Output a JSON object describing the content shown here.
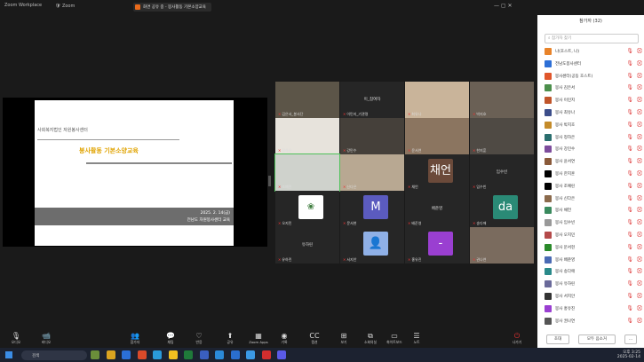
{
  "window": {
    "title": "Zoom",
    "app_label": "Zoom Workplace"
  },
  "share_bar": {
    "label": "화면 공유 중 - 봉사활동 기본소양교육"
  },
  "slide": {
    "header": "사회복지법인 자원봉사센터",
    "title": "봉사활동 기본소양교육",
    "line1": "2025. 2. 14(금)",
    "line2": "전남도 자원봉사센터 교육"
  },
  "gallery": [
    {
      "name": "김은서_봉사단",
      "kind": "video",
      "color": "#5c5548"
    },
    {
      "name": "이민지_기관명",
      "kind": "name",
      "center": "이_참여자"
    },
    {
      "name": "최유나",
      "kind": "video",
      "color": "#c9b49a"
    },
    {
      "name": "박지호",
      "kind": "video",
      "color": "#6a6055"
    },
    {
      "name": "정하은",
      "kind": "video",
      "color": "#e7e3dc"
    },
    {
      "name": "강민수",
      "kind": "video",
      "color": "#45403a"
    },
    {
      "name": "윤서연",
      "kind": "video",
      "color": "#8b7560"
    },
    {
      "name": "한지훈",
      "kind": "video",
      "color": "#4f4a44"
    },
    {
      "name": "조예린",
      "kind": "video",
      "color": "#cfd2cc",
      "active": true
    },
    {
      "name": "신다은",
      "kind": "video",
      "color": "#b8a892"
    },
    {
      "name": "채언",
      "kind": "avatar",
      "letter": "채언",
      "color": "#6b4a3a"
    },
    {
      "name": "임수빈",
      "kind": "name",
      "center": "임수빈"
    },
    {
      "name": "오지민",
      "kind": "logo",
      "color": "#fff"
    },
    {
      "name": "문서현",
      "kind": "avatar",
      "letter": "M",
      "color": "#5b5bbf"
    },
    {
      "name": "배준영",
      "kind": "name",
      "center": "배준영"
    },
    {
      "name": "송다애",
      "kind": "avatar",
      "letter": "da",
      "color": "#2a8a76"
    },
    {
      "name": "유하린",
      "kind": "name",
      "center": "유하린"
    },
    {
      "name": "서지안",
      "kind": "person",
      "color": "#3a5fa8"
    },
    {
      "name": "홍유진",
      "kind": "avatar",
      "letter": "-",
      "color": "#9a3fd1"
    },
    {
      "name": "권나연",
      "kind": "video",
      "color": "#7a6b5e"
    }
  ],
  "toolbar": [
    {
      "label": "오디오",
      "icon": "mic-icon",
      "glyph": "🎙"
    },
    {
      "label": "비디오",
      "icon": "camera-icon",
      "glyph": "📹"
    },
    {
      "label": "참가자",
      "icon": "participants-icon",
      "glyph": "👥"
    },
    {
      "label": "채팅",
      "icon": "chat-icon",
      "glyph": "💬"
    },
    {
      "label": "반응",
      "icon": "heart-icon",
      "glyph": "♡"
    },
    {
      "label": "공유",
      "icon": "share-icon",
      "glyph": "⬆"
    },
    {
      "label": "Zoom Apps",
      "icon": "apps-icon",
      "glyph": "▦"
    },
    {
      "label": "기록",
      "icon": "record-icon",
      "glyph": "◉"
    },
    {
      "label": "캡션",
      "icon": "caption-icon",
      "glyph": "CC"
    },
    {
      "label": "보기",
      "icon": "view-icon",
      "glyph": "⊞"
    },
    {
      "label": "소회의실",
      "icon": "breakout-icon",
      "glyph": "⧉"
    },
    {
      "label": "화이트보드",
      "icon": "whiteboard-icon",
      "glyph": "▭"
    },
    {
      "label": "노트",
      "icon": "notes-icon",
      "glyph": "☰"
    },
    {
      "label": "나가기",
      "icon": "leave-icon",
      "glyph": "⏻"
    }
  ],
  "panel": {
    "title": "참가자 (32)",
    "search_placeholder": "참가자 찾기",
    "invite": "초대",
    "mute_all": "모두 음소거",
    "participants": [
      {
        "name": "나(호스트, 나)",
        "color": "#e8832a"
      },
      {
        "name": "전남도봉사센터",
        "color": "#2d6fd6"
      },
      {
        "name": "봉사센터(공동 호스트)",
        "color": "#e0562b"
      },
      {
        "name": "봉사 김은서",
        "color": "#4c8f4c"
      },
      {
        "name": "봉사 이민지",
        "color": "#c0552a"
      },
      {
        "name": "봉사 최유나",
        "color": "#3c4e8a"
      },
      {
        "name": "봉사 박지호",
        "color": "#c48b2a"
      },
      {
        "name": "봉사 정하은",
        "color": "#2a6e6e"
      },
      {
        "name": "봉사 강민수",
        "color": "#7d4c9c"
      },
      {
        "name": "봉사 윤서연",
        "color": "#8a5a3a"
      },
      {
        "name": "봉사 한지훈",
        "color": "#000000"
      },
      {
        "name": "봉사 조예린",
        "color": "#000000"
      },
      {
        "name": "봉사 신다은",
        "color": "#8b6a4c"
      },
      {
        "name": "봉사 채언",
        "color": "#3a8a5e"
      },
      {
        "name": "봉사 임수빈",
        "color": "#999999"
      },
      {
        "name": "봉사 오지민",
        "color": "#b44a4a"
      },
      {
        "name": "봉사 문서현",
        "color": "#2a8a2a"
      },
      {
        "name": "봉사 배준영",
        "color": "#4a6ab4"
      },
      {
        "name": "봉사 송다애",
        "color": "#2a8a8a"
      },
      {
        "name": "봉사 유하린",
        "color": "#6a6a9a"
      },
      {
        "name": "봉사 서지안",
        "color": "#333333"
      },
      {
        "name": "봉사 홍유진",
        "color": "#9a3fd1"
      },
      {
        "name": "봉사 권나연",
        "color": "#555555"
      }
    ]
  },
  "taskbar": {
    "search": "검색",
    "time": "오후 3:25",
    "date": "2025-02-14"
  }
}
